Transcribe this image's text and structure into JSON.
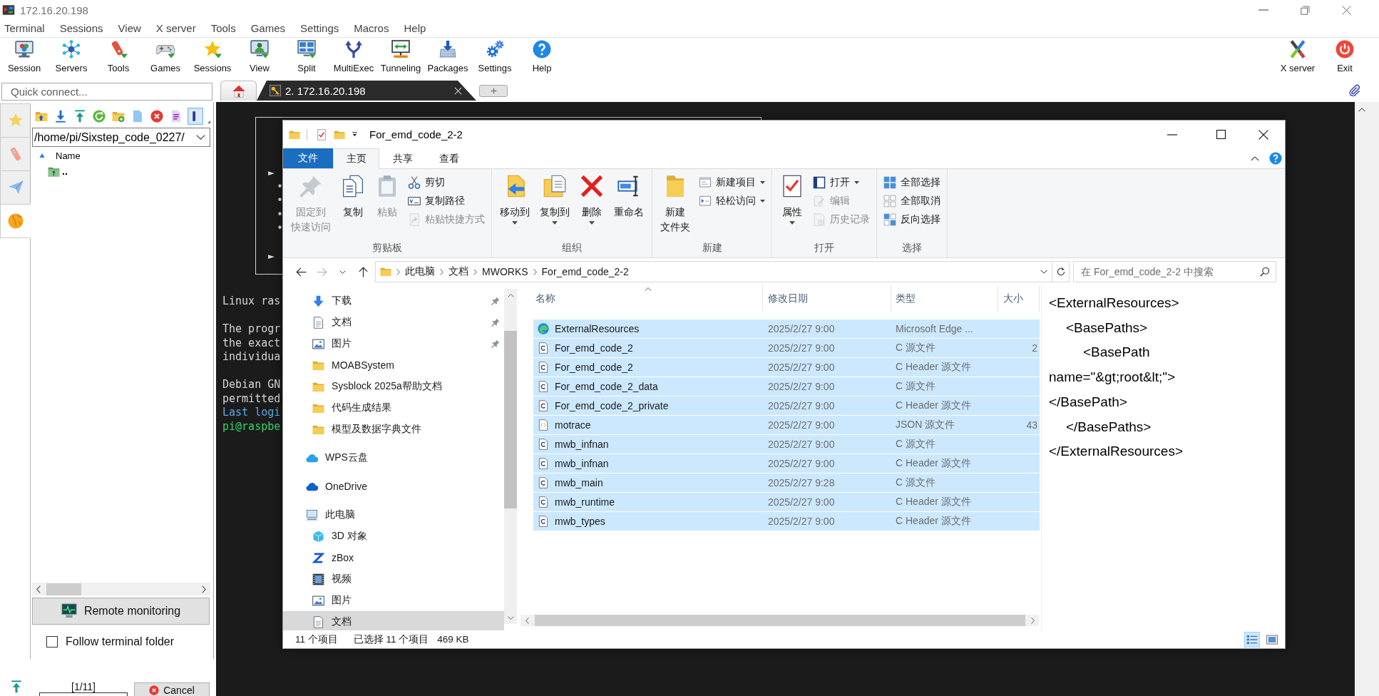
{
  "window": {
    "title": "172.16.20.198"
  },
  "menu": [
    "Terminal",
    "Sessions",
    "View",
    "X server",
    "Tools",
    "Games",
    "Settings",
    "Macros",
    "Help"
  ],
  "toolbar": [
    {
      "kind": "session",
      "label": "Session"
    },
    {
      "kind": "servers",
      "label": "Servers"
    },
    {
      "kind": "tools",
      "label": "Tools"
    },
    {
      "kind": "games",
      "label": "Games"
    },
    {
      "kind": "sessions",
      "label": "Sessions"
    },
    {
      "kind": "view",
      "label": "View"
    },
    {
      "kind": "split",
      "label": "Split"
    },
    {
      "kind": "multiexec",
      "label": "MultiExec"
    },
    {
      "kind": "tunneling",
      "label": "Tunneling"
    },
    {
      "kind": "packages",
      "label": "Packages"
    },
    {
      "kind": "settings",
      "label": "Settings"
    },
    {
      "kind": "help",
      "label": "Help"
    }
  ],
  "toolbar_right": [
    {
      "kind": "xserver",
      "label": "X server"
    },
    {
      "kind": "exit",
      "label": "Exit"
    }
  ],
  "quick_connect": {
    "placeholder": "Quick connect..."
  },
  "session_tabs": [
    {
      "kind": "home",
      "selected": false
    },
    {
      "kind": "ssh",
      "label": "2. 172.16.20.198",
      "selected": true
    },
    {
      "kind": "new",
      "selected": false
    }
  ],
  "sidebar": {
    "tabs": [
      {
        "kind": "star",
        "selected": false
      },
      {
        "kind": "tools",
        "selected": false
      },
      {
        "kind": "send",
        "selected": false
      },
      {
        "kind": "globe",
        "selected": true
      }
    ],
    "toolbar": [
      {
        "kind": "folder-up",
        "on": false
      },
      {
        "kind": "download",
        "on": false
      },
      {
        "kind": "upload",
        "on": false
      },
      {
        "kind": "refresh",
        "on": false
      },
      {
        "kind": "new-folder",
        "on": false
      },
      {
        "kind": "new-file",
        "on": false
      },
      {
        "kind": "delete",
        "on": false
      },
      {
        "kind": "text",
        "on": false
      },
      {
        "kind": "panel",
        "on": true
      }
    ],
    "path": "/home/pi/Sixstep_code_0227/",
    "column": "Name",
    "rows": [
      ".."
    ],
    "remote_monitoring": "Remote monitoring",
    "follow_terminal_folder": {
      "label": "Follow terminal folder",
      "checked": false
    },
    "transfer": {
      "counter": "[1/11]",
      "cancel": "Cancel"
    }
  },
  "terminal": {
    "box": [
      {
        "text": "►",
        "children": [
          {
            "text": "•"
          },
          {
            "text": "•"
          },
          {
            "text": "•"
          },
          {
            "text": "•"
          }
        ]
      },
      {
        "text": "►"
      }
    ],
    "paragraphs": [
      [
        {
          "kind": "output",
          "text": "Linux ras"
        }
      ],
      [
        {
          "kind": "output",
          "text": "The progr"
        },
        {
          "kind": "output",
          "text": "the exact"
        },
        {
          "kind": "output",
          "text": "individua"
        }
      ],
      [
        {
          "kind": "output",
          "text": "Debian GN"
        },
        {
          "kind": "output",
          "text": "permitted"
        },
        {
          "kind": "login",
          "text": "Last logi"
        },
        {
          "kind": "prompt",
          "text": "pi@raspbe"
        }
      ]
    ]
  },
  "explorer": {
    "title": "For_emd_code_2-2",
    "ribbon_tabs": [
      {
        "kind": "file",
        "label": "文件",
        "selected": false
      },
      {
        "kind": "tab",
        "label": "主页",
        "selected": true
      },
      {
        "kind": "tab",
        "label": "共享",
        "selected": false
      },
      {
        "kind": "tab",
        "label": "查看",
        "selected": false
      }
    ],
    "ribbon_groups": [
      {
        "label": "剪贴板",
        "items": [
          {
            "kind": "pin",
            "lines": [
              "固定到",
              "快速访问"
            ],
            "disabled": true,
            "dropdown": false
          },
          {
            "kind": "copy",
            "lines": [
              "复制"
            ],
            "disabled": false,
            "dropdown": false
          },
          {
            "kind": "paste",
            "lines": [
              "粘贴"
            ],
            "disabled": true,
            "dropdown": false
          },
          {
            "kind": "stack",
            "buttons": [
              {
                "kind": "cut",
                "label": "剪切",
                "disabled": false,
                "dropdown": false
              },
              {
                "kind": "copy-path",
                "label": "复制路径",
                "disabled": false,
                "dropdown": false
              },
              {
                "kind": "paste-shortcut",
                "label": "粘贴快捷方式",
                "disabled": true,
                "dropdown": false
              }
            ]
          }
        ]
      },
      {
        "label": "组织",
        "items": [
          {
            "kind": "move-to",
            "lines": [
              "移动到"
            ],
            "disabled": false,
            "dropdown": true
          },
          {
            "kind": "copy-to",
            "lines": [
              "复制到"
            ],
            "disabled": false,
            "dropdown": true
          },
          {
            "kind": "delete",
            "lines": [
              "删除"
            ],
            "disabled": false,
            "dropdown": true
          },
          {
            "kind": "rename",
            "lines": [
              "重命名"
            ],
            "disabled": false,
            "dropdown": false
          }
        ]
      },
      {
        "label": "新建",
        "items": [
          {
            "kind": "new-folder",
            "lines": [
              "新建",
              "文件夹"
            ],
            "disabled": false,
            "dropdown": false
          },
          {
            "kind": "stack",
            "buttons": [
              {
                "kind": "new-item",
                "label": "新建项目",
                "disabled": false,
                "dropdown": true
              },
              {
                "kind": "easy-access",
                "label": "轻松访问",
                "disabled": false,
                "dropdown": true
              }
            ]
          }
        ]
      },
      {
        "label": "打开",
        "items": [
          {
            "kind": "properties",
            "lines": [
              "属性"
            ],
            "disabled": false,
            "dropdown": true
          },
          {
            "kind": "stack",
            "buttons": [
              {
                "kind": "open",
                "label": "打开",
                "disabled": false,
                "dropdown": true
              },
              {
                "kind": "edit",
                "label": "编辑",
                "disabled": true,
                "dropdown": false
              },
              {
                "kind": "history",
                "label": "历史记录",
                "disabled": true,
                "dropdown": false
              }
            ]
          }
        ]
      },
      {
        "label": "选择",
        "items": [
          {
            "kind": "stack",
            "buttons": [
              {
                "kind": "select-all",
                "label": "全部选择",
                "disabled": false,
                "dropdown": false
              },
              {
                "kind": "select-none",
                "label": "全部取消",
                "disabled": false,
                "dropdown": false
              },
              {
                "kind": "invert",
                "label": "反向选择",
                "disabled": false,
                "dropdown": false
              }
            ]
          }
        ]
      }
    ],
    "address": {
      "nav_buttons": [
        {
          "kind": "back",
          "disabled": false
        },
        {
          "kind": "forward",
          "disabled": true
        },
        {
          "kind": "recent",
          "disabled": false
        },
        {
          "kind": "up",
          "disabled": false
        }
      ],
      "crumbs": [
        "此电脑",
        "文档",
        "MWORKS",
        "For_emd_code_2-2"
      ],
      "search_placeholder": "在 For_emd_code_2-2 中搜索"
    },
    "nav_pane": {
      "quick_access": [
        {
          "kind": "download",
          "label": "下载",
          "pinned": true,
          "selected": false
        },
        {
          "kind": "documents",
          "label": "文档",
          "pinned": true,
          "selected": false
        },
        {
          "kind": "pictures",
          "label": "图片",
          "pinned": true,
          "selected": false
        },
        {
          "kind": "folder",
          "label": "MOABSystem",
          "pinned": false,
          "selected": false
        },
        {
          "kind": "folder",
          "label": "Sysblock 2025a帮助文档",
          "pinned": false,
          "selected": false
        },
        {
          "kind": "folder",
          "label": "代码生成结果",
          "pinned": false,
          "selected": false
        },
        {
          "kind": "folder",
          "label": "模型及数据字典文件",
          "pinned": false,
          "selected": false
        }
      ],
      "locations": [
        {
          "kind": "wps-cloud",
          "label": "WPS云盘",
          "selected": false
        },
        {
          "kind": "onedrive",
          "label": "OneDrive",
          "selected": false
        },
        {
          "kind": "pc",
          "label": "此电脑",
          "selected": false,
          "children": [
            {
              "kind": "cube",
              "label": "3D 对象",
              "selected": false
            },
            {
              "kind": "zbox",
              "label": "zBox",
              "selected": false
            },
            {
              "kind": "videos",
              "label": "视频",
              "selected": false
            },
            {
              "kind": "pictures",
              "label": "图片",
              "selected": false
            },
            {
              "kind": "documents",
              "label": "文档",
              "selected": true
            }
          ]
        }
      ]
    },
    "columns": [
      {
        "label": "名称",
        "sorted": true
      },
      {
        "label": "修改日期",
        "sorted": false
      },
      {
        "label": "类型",
        "sorted": false
      },
      {
        "label": "大小",
        "sorted": false
      }
    ],
    "files": [
      {
        "kind": "edge",
        "name": "ExternalResources",
        "modified": "2025/2/27 9:00",
        "type": "Microsoft Edge ...",
        "selected": true
      },
      {
        "kind": "c",
        "name": "For_emd_code_2",
        "modified": "2025/2/27 9:00",
        "type": "C 源文件",
        "size": "2",
        "selected": true
      },
      {
        "kind": "c",
        "name": "For_emd_code_2",
        "modified": "2025/2/27 9:00",
        "type": "C Header 源文件",
        "selected": true
      },
      {
        "kind": "c",
        "name": "For_emd_code_2_data",
        "modified": "2025/2/27 9:00",
        "type": "C 源文件",
        "selected": true
      },
      {
        "kind": "c",
        "name": "For_emd_code_2_private",
        "modified": "2025/2/27 9:00",
        "type": "C Header 源文件",
        "selected": true
      },
      {
        "kind": "json",
        "name": "motrace",
        "modified": "2025/2/27 9:00",
        "type": "JSON 源文件",
        "size": "43",
        "selected": true
      },
      {
        "kind": "c",
        "name": "mwb_infnan",
        "modified": "2025/2/27 9:00",
        "type": "C 源文件",
        "selected": true
      },
      {
        "kind": "c",
        "name": "mwb_infnan",
        "modified": "2025/2/27 9:00",
        "type": "C Header 源文件",
        "selected": true
      },
      {
        "kind": "c",
        "name": "mwb_main",
        "modified": "2025/2/27 9:28",
        "type": "C 源文件",
        "selected": true
      },
      {
        "kind": "c",
        "name": "mwb_runtime",
        "modified": "2025/2/27 9:00",
        "type": "C Header 源文件",
        "selected": true
      },
      {
        "kind": "c",
        "name": "mwb_types",
        "modified": "2025/2/27 9:00",
        "type": "C Header 源文件",
        "selected": true
      }
    ],
    "preview": [
      {
        "text": "<ExternalResources>",
        "children": [
          {
            "text": "<BasePaths>",
            "children": [
              {
                "text": "<BasePath"
              }
            ]
          }
        ]
      },
      {
        "text": "name=\"&gt;root&lt;\">"
      },
      {
        "text": "</BasePath>",
        "children": [
          {
            "text": "</BasePaths>"
          }
        ]
      },
      {
        "text": "</ExternalResources>"
      }
    ],
    "status": {
      "count": "11 个项目",
      "selection": "已选择 11 个项目",
      "size": "469 KB",
      "views": [
        {
          "kind": "details",
          "selected": true
        },
        {
          "kind": "tiles",
          "selected": false
        }
      ]
    }
  }
}
